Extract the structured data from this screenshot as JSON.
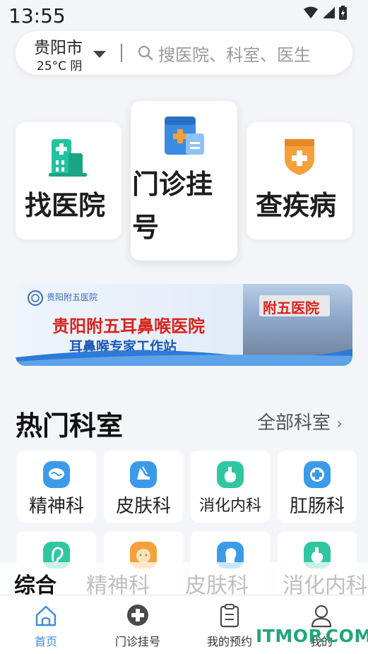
{
  "status_bar": {
    "time": "13:55"
  },
  "location": {
    "city": "贵阳市",
    "weather": "25°C 阴"
  },
  "search": {
    "placeholder": "搜医院、科室、医生"
  },
  "quick_actions": {
    "find_hospital": "找医院",
    "register_line1": "门诊挂",
    "register_line2": "号",
    "check_disease": "查疾病"
  },
  "banner": {
    "logo_text": "贵阳附五医院",
    "title": "贵阳附五耳鼻喉医院",
    "subtitle": "耳鼻喉专家工作站",
    "sign_text": "附五医院"
  },
  "hot_departments": {
    "title": "热门科室",
    "more": "全部科室",
    "items": [
      {
        "label": "精神科",
        "icon": "brain-icon",
        "color": "#3b9be8"
      },
      {
        "label": "皮肤科",
        "icon": "skin-icon",
        "color": "#3b9be8"
      },
      {
        "label": "消化内科",
        "icon": "stomach-icon",
        "color": "#2fc7a0"
      },
      {
        "label": "肛肠科",
        "icon": "intestine-icon",
        "color": "#3b9be8"
      },
      {
        "label": "",
        "icon": "ear-icon",
        "color": "#2fc7a0"
      },
      {
        "label": "",
        "icon": "baby-icon",
        "color": "#f5a03b"
      },
      {
        "label": "",
        "icon": "head-icon",
        "color": "#3b9be8"
      },
      {
        "label": "",
        "icon": "stomach-icon",
        "color": "#2fc7a0"
      }
    ]
  },
  "category_tabs": [
    "综合",
    "精神科",
    "皮肤科",
    "消化内科"
  ],
  "nav": {
    "home": "首页",
    "register": "门诊挂号",
    "appointments": "我的预约",
    "profile": "我的"
  },
  "watermark": "ITMOP.COM",
  "colors": {
    "accent": "#3a8ce0",
    "green": "#22c3a0",
    "orange": "#f5a03b",
    "red": "#d8241b"
  }
}
